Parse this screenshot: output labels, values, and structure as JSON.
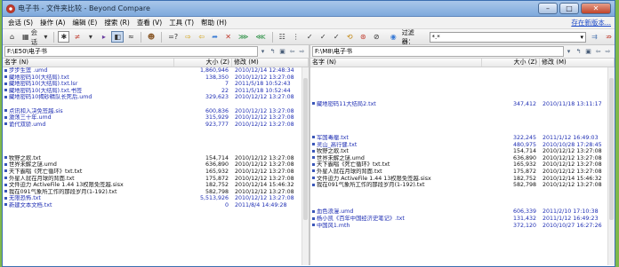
{
  "window": {
    "title": "电子书 - 文件夹比较 - Beyond Compare",
    "controls": [
      "–",
      "□",
      "✕"
    ]
  },
  "menu": {
    "items": [
      "会话 (S)",
      "操作 (A)",
      "编辑 (E)",
      "搜索 (R)",
      "查看 (V)",
      "工具 (T)",
      "帮助 (H)"
    ],
    "new_version": "存在新版本..."
  },
  "toolbar": {
    "session_label": "会话",
    "filter_label": "过滤器：",
    "filter_value": "*.*"
  },
  "left": {
    "path": "F:\\E50\\电子书",
    "columns": {
      "name": "名字 (N)",
      "size": "大小 (Z)",
      "modified": "修改 (M)"
    },
    "rows": [
      {
        "name": "步步生莲 .umd",
        "size": "1,860,946",
        "modified": "2010/12/14 12:48:34",
        "tone": "blue"
      },
      {
        "name": "藏地密码10(大结局).txt",
        "size": "138,350",
        "modified": "2010/12/12 13:27:08",
        "tone": "blue"
      },
      {
        "name": "藏地密码10(大结局).txt.lsr",
        "size": "7",
        "modified": "2011/5/18 10:52:43",
        "tone": "blue"
      },
      {
        "name": "藏地密码10(大结局).txt.书签",
        "size": "22",
        "modified": "2011/5/18 10:52:44",
        "tone": "blue"
      },
      {
        "name": "藏地密码10揭砂精队长死后.umd",
        "size": "329,623",
        "modified": "2010/12/12 13:27:08",
        "tone": "blue"
      },
      {
        "name": "",
        "size": "",
        "modified": "",
        "tone": "blue"
      },
      {
        "name": "点讯和入决免签越.sis",
        "size": "600,836",
        "modified": "2010/12/12 13:27:08",
        "tone": "blue"
      },
      {
        "name": "激荡三十年.umd",
        "size": "315,929",
        "modified": "2010/12/12 13:27:08",
        "tone": "blue"
      },
      {
        "name": "诡代双骄.umd",
        "size": "923,777",
        "modified": "2010/12/12 13:27:08",
        "tone": "blue"
      },
      {
        "name": "",
        "size": "",
        "modified": "",
        "tone": "blue"
      },
      {
        "name": "",
        "size": "",
        "modified": "",
        "tone": "blue"
      },
      {
        "name": "",
        "size": "",
        "modified": "",
        "tone": "blue"
      },
      {
        "name": "",
        "size": "",
        "modified": "",
        "tone": "blue"
      },
      {
        "name": "牧野之歌.txt",
        "size": "154,714",
        "modified": "2010/12/12 13:27:08",
        "tone": "black"
      },
      {
        "name": "世界未解之谜.umd",
        "size": "636,890",
        "modified": "2010/12/12 13:27:08",
        "tone": "black"
      },
      {
        "name": "天下霸唱《死亡循环》txt.txt",
        "size": "165,932",
        "modified": "2010/12/12 13:27:08",
        "tone": "black"
      },
      {
        "name": "外星人就在月球的背面.txt",
        "size": "175,872",
        "modified": "2010/12/12 13:27:08",
        "tone": "black"
      },
      {
        "name": "文件迫力 ActiveFile 1.44 13权限免签越.sisx",
        "size": "182,752",
        "modified": "2010/12/14 15:46:32",
        "tone": "black"
      },
      {
        "name": "我在091气象所工作的那段岁月(1-192).txt",
        "size": "582,798",
        "modified": "2010/12/12 13:27:08",
        "tone": "black"
      },
      {
        "name": "无限恐怖.txt",
        "size": "5,513,926",
        "modified": "2010/12/12 13:27:08",
        "tone": "blue"
      },
      {
        "name": "新建文本文档.txt",
        "size": "0",
        "modified": "2011/8/4 14:49:28",
        "tone": "blue"
      }
    ]
  },
  "right": {
    "path": "F:\\M8\\电子书",
    "columns": {
      "name": "名字 (N)",
      "size": "大小 (Z)",
      "modified": "修改 (M)"
    },
    "rows": [
      {
        "name": "",
        "size": "",
        "modified": "",
        "tone": "blue"
      },
      {
        "name": "",
        "size": "",
        "modified": "",
        "tone": "blue"
      },
      {
        "name": "",
        "size": "",
        "modified": "",
        "tone": "blue"
      },
      {
        "name": "",
        "size": "",
        "modified": "",
        "tone": "blue"
      },
      {
        "name": "",
        "size": "",
        "modified": "",
        "tone": "blue"
      },
      {
        "name": "藏地密码11大结局2.txt",
        "size": "347,412",
        "modified": "2010/11/18 13:11:17",
        "tone": "blue"
      },
      {
        "name": "",
        "size": "",
        "modified": "",
        "tone": "blue"
      },
      {
        "name": "",
        "size": "",
        "modified": "",
        "tone": "blue"
      },
      {
        "name": "",
        "size": "",
        "modified": "",
        "tone": "blue"
      },
      {
        "name": "",
        "size": "",
        "modified": "",
        "tone": "blue"
      },
      {
        "name": "军国毒瘤.txt",
        "size": "322,245",
        "modified": "2011/1/12 16:49:03",
        "tone": "blue"
      },
      {
        "name": "灵山_高行健.txt",
        "size": "480,975",
        "modified": "2010/10/28 17:28:45",
        "tone": "blue"
      },
      {
        "name": "牧野之歌.txt",
        "size": "154,714",
        "modified": "2010/12/12 13:27:08",
        "tone": "black"
      },
      {
        "name": "世界未解之谜.umd",
        "size": "636,890",
        "modified": "2010/12/12 13:27:08",
        "tone": "black"
      },
      {
        "name": "天下霸唱《死亡循环》txt.txt",
        "size": "165,932",
        "modified": "2010/12/12 13:27:08",
        "tone": "black"
      },
      {
        "name": "外星人就在月球的背面.txt",
        "size": "175,872",
        "modified": "2010/12/12 13:27:08",
        "tone": "black"
      },
      {
        "name": "文件迫力 ActiveFile 1.44 13权限免签越.sisx",
        "size": "182,752",
        "modified": "2010/12/14 15:46:32",
        "tone": "black"
      },
      {
        "name": "我在091气象所工作的那段岁月(1-192).txt",
        "size": "582,798",
        "modified": "2010/12/12 13:27:08",
        "tone": "black"
      },
      {
        "name": "",
        "size": "",
        "modified": "",
        "tone": "blue"
      },
      {
        "name": "",
        "size": "",
        "modified": "",
        "tone": "blue"
      },
      {
        "name": "",
        "size": "",
        "modified": "",
        "tone": "blue"
      },
      {
        "name": "血色浪漫.umd",
        "size": "606,339",
        "modified": "2011/2/10 17:10:38",
        "tone": "blue"
      },
      {
        "name": "杨小凯《百年中国经济史笔记》.txt",
        "size": "131,432",
        "modified": "2011/1/12 16:49:23",
        "tone": "blue"
      },
      {
        "name": "中国风1.mth",
        "size": "372,120",
        "modified": "2010/10/27 16:27:26",
        "tone": "blue"
      }
    ]
  }
}
